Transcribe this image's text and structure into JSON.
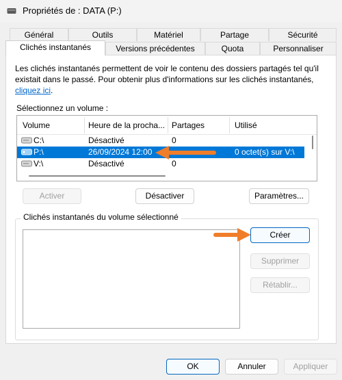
{
  "window": {
    "title": "Propriétés de : DATA (P:)"
  },
  "tabs_row1": [
    "Général",
    "Outils",
    "Matériel",
    "Partage",
    "Sécurité"
  ],
  "tabs_row2": [
    "Clichés instantanés",
    "Versions précédentes",
    "Quota",
    "Personnaliser"
  ],
  "active_tab": "Clichés instantanés",
  "description": {
    "text": "Les clichés instantanés permettent de voir le contenu des dossiers partagés tel qu'il existait dans le passé. Pour obtenir plus d'informations sur les clichés instantanés,",
    "link": "cliquez ici",
    "end": "."
  },
  "volume_section": {
    "label": "Sélectionnez un volume :",
    "columns": [
      "Volume",
      "Heure de la procha...",
      "Partages",
      "Utilisé"
    ],
    "rows": [
      {
        "volume": "C:\\",
        "next_time": "Désactivé",
        "shares": "0",
        "used": "",
        "selected": false
      },
      {
        "volume": "P:\\",
        "next_time": "26/09/2024 12:00",
        "shares": "",
        "used": "0 octet(s) sur V:\\",
        "selected": true
      },
      {
        "volume": "V:\\",
        "next_time": "Désactivé",
        "shares": "0",
        "used": "",
        "selected": false
      }
    ]
  },
  "buttons": {
    "activate": "Activer",
    "deactivate": "Désactiver",
    "settings": "Paramètres...",
    "create": "Créer",
    "delete": "Supprimer",
    "restore": "Rétablir...",
    "ok": "OK",
    "cancel": "Annuler",
    "apply": "Appliquer"
  },
  "snapshots_group": {
    "label": "Clichés instantanés du volume sélectionné"
  },
  "colors": {
    "accent": "#0078d7",
    "arrow": "#f07d2a",
    "link": "#0066cc"
  }
}
